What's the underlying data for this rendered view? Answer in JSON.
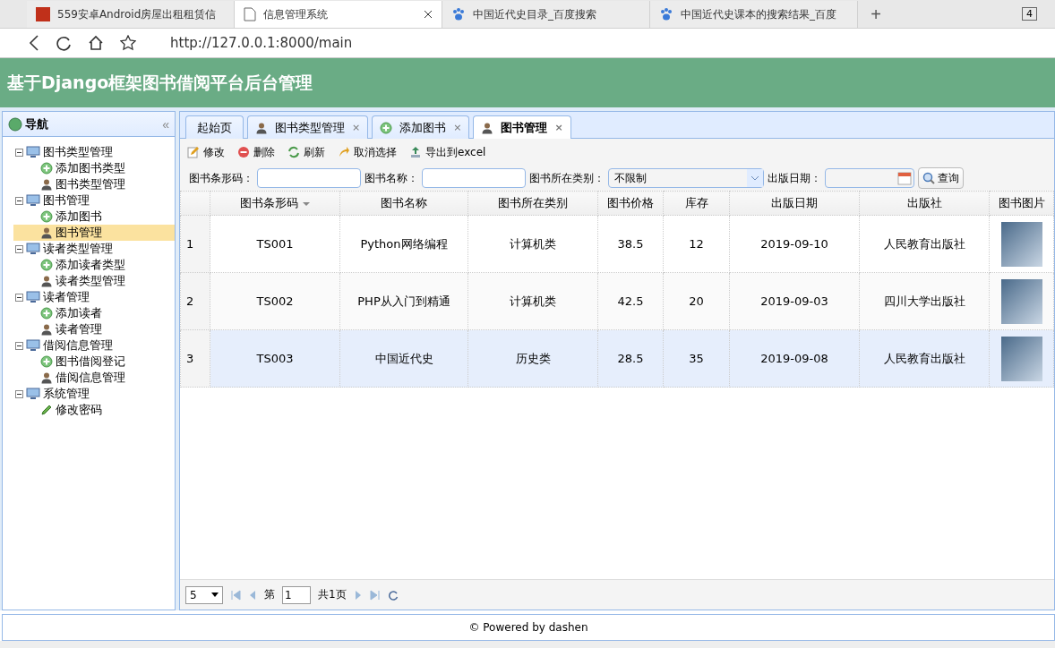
{
  "browser": {
    "tabs": [
      {
        "title": "559安卓Android房屋出租租赁信",
        "kind": "app",
        "selected": false
      },
      {
        "title": "信息管理系统",
        "kind": "page",
        "selected": true
      },
      {
        "title": "中国近代史目录_百度搜索",
        "kind": "paw",
        "selected": false
      },
      {
        "title": "中国近代史课本的搜索结果_百度",
        "kind": "paw",
        "selected": false
      }
    ],
    "new_tab": "+",
    "tab_count": "4",
    "url": "http://127.0.0.1:8000/main"
  },
  "header": {
    "title": "基于Django框架图书借阅平台后台管理"
  },
  "sidebar": {
    "title": "导航",
    "collapse": "«",
    "tree": [
      {
        "label": "图书类型管理",
        "expanded": true,
        "children": [
          {
            "label": "添加图书类型",
            "kind": "add",
            "selected": false
          },
          {
            "label": "图书类型管理",
            "kind": "user",
            "selected": false
          }
        ]
      },
      {
        "label": "图书管理",
        "expanded": true,
        "children": [
          {
            "label": "添加图书",
            "kind": "add",
            "selected": false
          },
          {
            "label": "图书管理",
            "kind": "user",
            "selected": true
          }
        ]
      },
      {
        "label": "读者类型管理",
        "expanded": true,
        "children": [
          {
            "label": "添加读者类型",
            "kind": "add",
            "selected": false
          },
          {
            "label": "读者类型管理",
            "kind": "user",
            "selected": false
          }
        ]
      },
      {
        "label": "读者管理",
        "expanded": true,
        "children": [
          {
            "label": "添加读者",
            "kind": "add",
            "selected": false
          },
          {
            "label": "读者管理",
            "kind": "user",
            "selected": false
          }
        ]
      },
      {
        "label": "借阅信息管理",
        "expanded": true,
        "children": [
          {
            "label": "图书借阅登记",
            "kind": "add",
            "selected": false
          },
          {
            "label": "借阅信息管理",
            "kind": "user",
            "selected": false
          }
        ]
      },
      {
        "label": "系统管理",
        "expanded": true,
        "children": [
          {
            "label": "修改密码",
            "kind": "edit",
            "selected": false
          }
        ]
      }
    ]
  },
  "content_tabs": [
    {
      "label": "起始页",
      "kind": "plain",
      "closable": false,
      "selected": false
    },
    {
      "label": "图书类型管理",
      "kind": "user",
      "closable": true,
      "selected": false
    },
    {
      "label": "添加图书",
      "kind": "add",
      "closable": true,
      "selected": false
    },
    {
      "label": "图书管理",
      "kind": "user",
      "closable": true,
      "selected": true
    }
  ],
  "close_mark": "×",
  "toolbar": [
    {
      "label": "修改",
      "kind": "edit"
    },
    {
      "label": "删除",
      "kind": "delete"
    },
    {
      "label": "刷新",
      "kind": "refresh"
    },
    {
      "label": "取消选择",
      "kind": "undo"
    },
    {
      "label": "导出到excel",
      "kind": "export"
    }
  ],
  "filters": [
    {
      "label": "图书条形码：",
      "kind": "text"
    },
    {
      "label": "图书名称：",
      "kind": "text"
    },
    {
      "label": "图书所在类别：",
      "kind": "select",
      "value": "不限制"
    },
    {
      "label": "出版日期：",
      "kind": "date"
    }
  ],
  "search_button": "查询",
  "table": {
    "columns": [
      {
        "label": "图书条形码",
        "sorted": true
      },
      {
        "label": "图书名称",
        "sorted": false
      },
      {
        "label": "图书所在类别",
        "sorted": false
      },
      {
        "label": "图书价格",
        "sorted": false
      },
      {
        "label": "库存",
        "sorted": false
      },
      {
        "label": "出版日期",
        "sorted": false
      },
      {
        "label": "出版社",
        "sorted": false
      },
      {
        "label": "图书图片",
        "sorted": false
      }
    ],
    "rows": [
      {
        "number": "1",
        "cells": [
          "TS001",
          "Python网络编程",
          "计算机类",
          "38.5",
          "12",
          "2019-09-10",
          "人民教育出版社"
        ],
        "selected": false
      },
      {
        "number": "2",
        "cells": [
          "TS002",
          "PHP从入门到精通",
          "计算机类",
          "42.5",
          "20",
          "2019-09-03",
          "四川大学出版社"
        ],
        "selected": false
      },
      {
        "number": "3",
        "cells": [
          "TS003",
          "中国近代史",
          "历史类",
          "28.5",
          "35",
          "2019-09-08",
          "人民教育出版社"
        ],
        "selected": true
      }
    ]
  },
  "pagination": {
    "page_size": "5",
    "page_prefix": "第",
    "page": "1",
    "total": "共1页"
  },
  "footer": "© Powered by dashen"
}
